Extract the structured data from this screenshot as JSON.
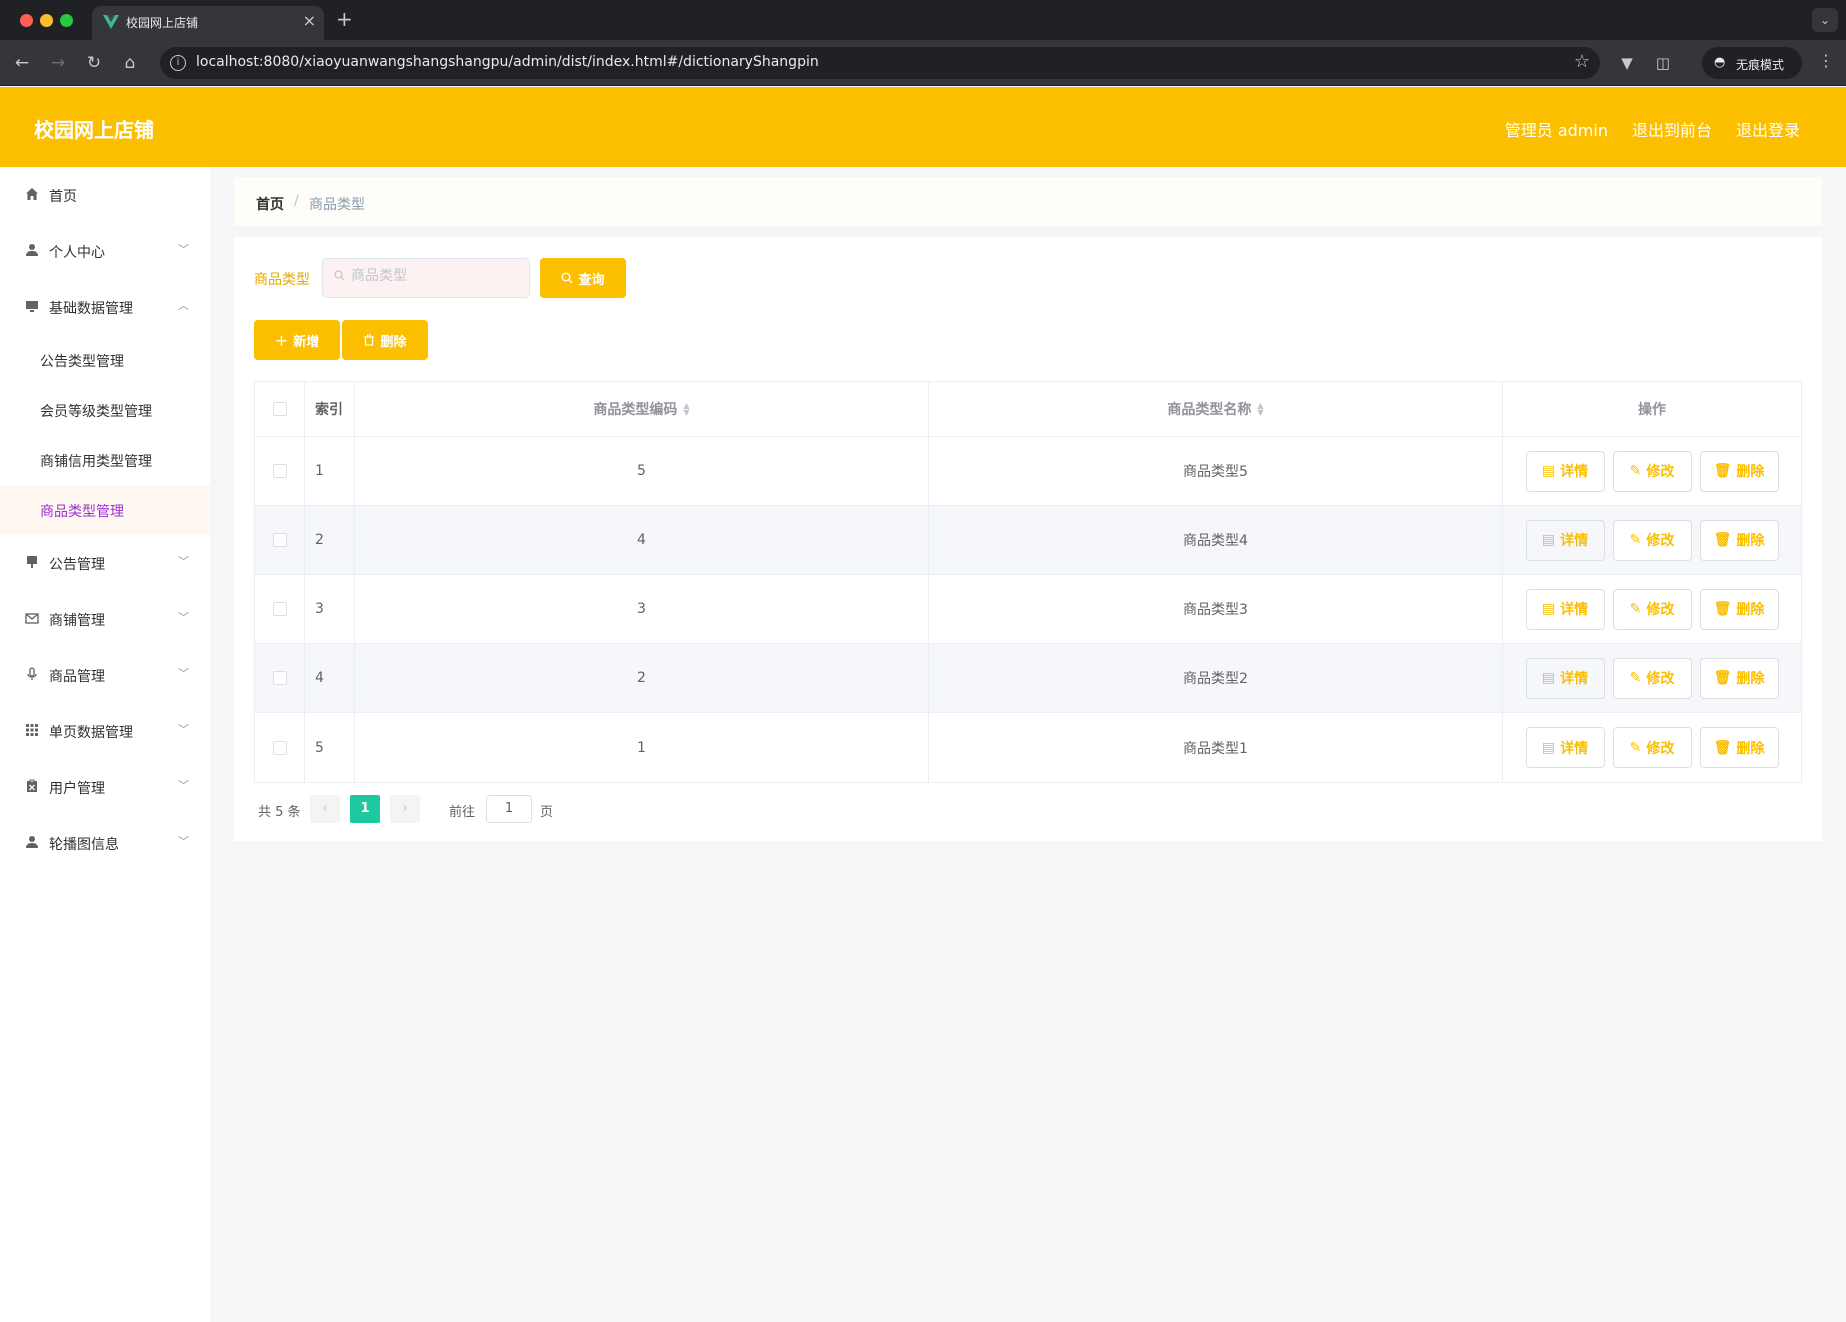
{
  "browser": {
    "tab_title": "校园网上店铺",
    "url": "localhost:8080/xiaoyuanwangshangshangpu/admin/dist/index.html#/dictionaryShangpin",
    "incognito_label": "无痕模式"
  },
  "header": {
    "title": "校园网上店铺",
    "admin_label": "管理员 admin",
    "back_to_front": "退出到前台",
    "logout": "退出登录",
    "color": "#fbbf00"
  },
  "sidebar": {
    "items": [
      {
        "label": "首页",
        "icon": "home-icon"
      },
      {
        "label": "个人中心",
        "icon": "user-icon"
      },
      {
        "label": "基础数据管理",
        "icon": "monitor-icon"
      },
      {
        "label": "公告管理",
        "icon": "brush-icon"
      },
      {
        "label": "商铺管理",
        "icon": "mail-icon"
      },
      {
        "label": "商品管理",
        "icon": "microphone-icon"
      },
      {
        "label": "单页数据管理",
        "icon": "grid-icon"
      },
      {
        "label": "用户管理",
        "icon": "clipboard-icon"
      },
      {
        "label": "轮播图信息",
        "icon": "user-icon"
      }
    ],
    "sub_items": [
      {
        "label": "公告类型管理"
      },
      {
        "label": "会员等级类型管理"
      },
      {
        "label": "商铺信用类型管理"
      },
      {
        "label": "商品类型管理",
        "active": true
      }
    ]
  },
  "breadcrumb": {
    "home": "首页",
    "separator": "/",
    "current": "商品类型"
  },
  "search": {
    "label": "商品类型",
    "placeholder": "商品类型",
    "query_button": "查询"
  },
  "actions": {
    "add": "新增",
    "delete": "删除"
  },
  "table": {
    "columns": [
      "索引",
      "商品类型编码",
      "商品类型名称",
      "操作"
    ],
    "rows": [
      {
        "index": "1",
        "code": "5",
        "name": "商品类型5"
      },
      {
        "index": "2",
        "code": "4",
        "name": "商品类型4"
      },
      {
        "index": "3",
        "code": "3",
        "name": "商品类型3"
      },
      {
        "index": "4",
        "code": "2",
        "name": "商品类型2"
      },
      {
        "index": "5",
        "code": "1",
        "name": "商品类型1"
      }
    ],
    "op_labels": {
      "detail": "详情",
      "edit": "修改",
      "delete": "删除"
    }
  },
  "pagination": {
    "total_text": "共 5 条",
    "current_page": "1",
    "goto_label": "前往",
    "goto_value": "1",
    "page_suffix": "页",
    "active_color": "#1ec99f"
  }
}
